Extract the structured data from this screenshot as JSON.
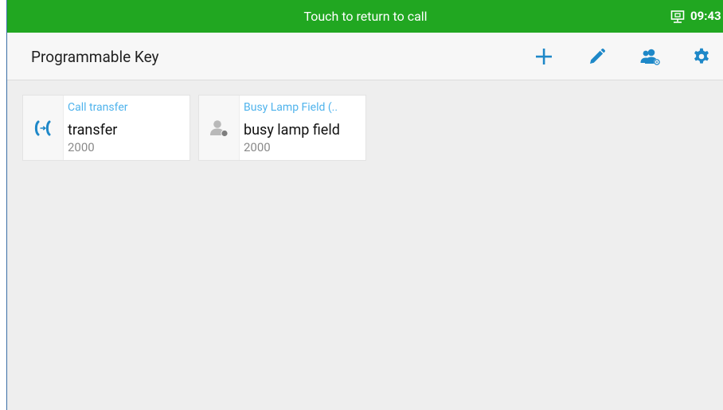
{
  "status_bar": {
    "return_text": "Touch to return to call",
    "time": "09:43",
    "network_icon": "ethernet-icon",
    "background_color": "#21a721"
  },
  "header": {
    "title": "Programmable Key",
    "actions": [
      {
        "icon": "add-icon",
        "color": "#1e88c8"
      },
      {
        "icon": "edit-icon",
        "color": "#1e88c8"
      },
      {
        "icon": "contacts-icon",
        "color": "#1e88c8"
      },
      {
        "icon": "settings-icon",
        "color": "#1e88c8"
      }
    ]
  },
  "keys": [
    {
      "type": "Call transfer",
      "name": "transfer",
      "number": "2000",
      "icon": "call-transfer-icon"
    },
    {
      "type": "Busy Lamp Field (..",
      "name": "busy lamp field",
      "number": "2000",
      "icon": "contact-status-icon"
    }
  ],
  "colors": {
    "accent": "#1e88c8",
    "type_label": "#4fb3ec",
    "background": "#eeeeee"
  }
}
